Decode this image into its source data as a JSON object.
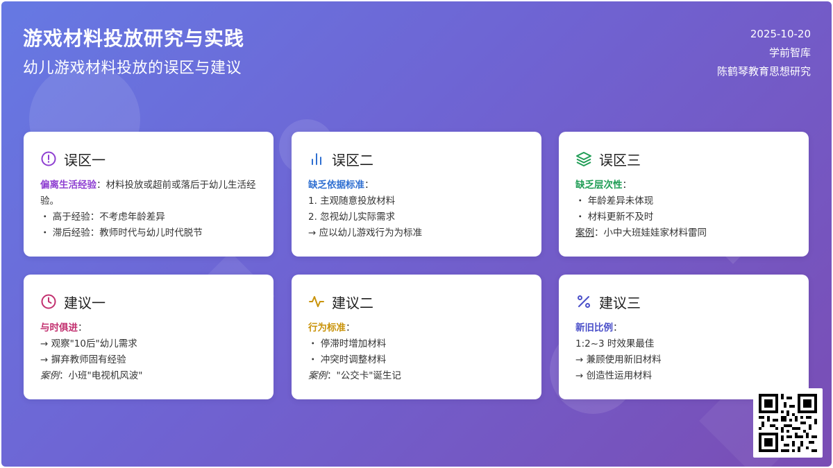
{
  "header": {
    "title": "游戏材料投放研究与实践",
    "subtitle": "幼儿游戏材料投放的误区与建议",
    "date": "2025-10-20",
    "org": "学前智库",
    "series": "陈鹤琴教育思想研究"
  },
  "cards": [
    {
      "title": "误区一",
      "icon": "alert-circle-icon",
      "accent": "#8e3fd1",
      "lead": "偏离生活经验",
      "lead_text": "：材料投放或超前或落后于幼儿生活经验。",
      "lines": [
        "・ 高于经验：不考虑年龄差异",
        "・ 滞后经验：教师时代与幼儿时代脱节"
      ]
    },
    {
      "title": "误区二",
      "icon": "bar-chart-icon",
      "accent": "#2f6fd1",
      "lead": "缺乏依据标准",
      "lead_text": "：",
      "lines": [
        "1. 主观随意投放材料",
        "2. 忽视幼儿实际需求",
        "→ 应以幼儿游戏行为为标准"
      ]
    },
    {
      "title": "误区三",
      "icon": "layers-icon",
      "accent": "#1f9d55",
      "lead": "缺乏层次性",
      "lead_text": "：",
      "lines": [
        "・ 年龄差异未体现",
        "・ 材料更新不及时"
      ],
      "case_label": "案例",
      "case_text": "：小中大班娃娃家材料雷同"
    },
    {
      "title": "建议一",
      "icon": "clock-icon",
      "accent": "#c2306f",
      "lead": "与时俱进",
      "lead_text": "：",
      "lines": [
        "→ 观察\"10后\"幼儿需求",
        "→ 摒弃教师固有经验"
      ],
      "case_label": "案例",
      "case_text": "：小班\"电视机风波\""
    },
    {
      "title": "建议二",
      "icon": "activity-icon",
      "accent": "#c9930a",
      "lead": "行为标准",
      "lead_text": "：",
      "lines": [
        "・ 停滞时增加材料",
        "・ 冲突时调整材料"
      ],
      "case_label": "案例",
      "case_text": "：\"公交卡\"诞生记"
    },
    {
      "title": "建议三",
      "icon": "percent-icon",
      "accent": "#4a4fc9",
      "lead": "新旧比例",
      "lead_text": "：",
      "lines": [
        "1:2~3 时效果最佳",
        "→ 兼顾使用新旧材料",
        "→ 创造性运用材料"
      ]
    }
  ]
}
